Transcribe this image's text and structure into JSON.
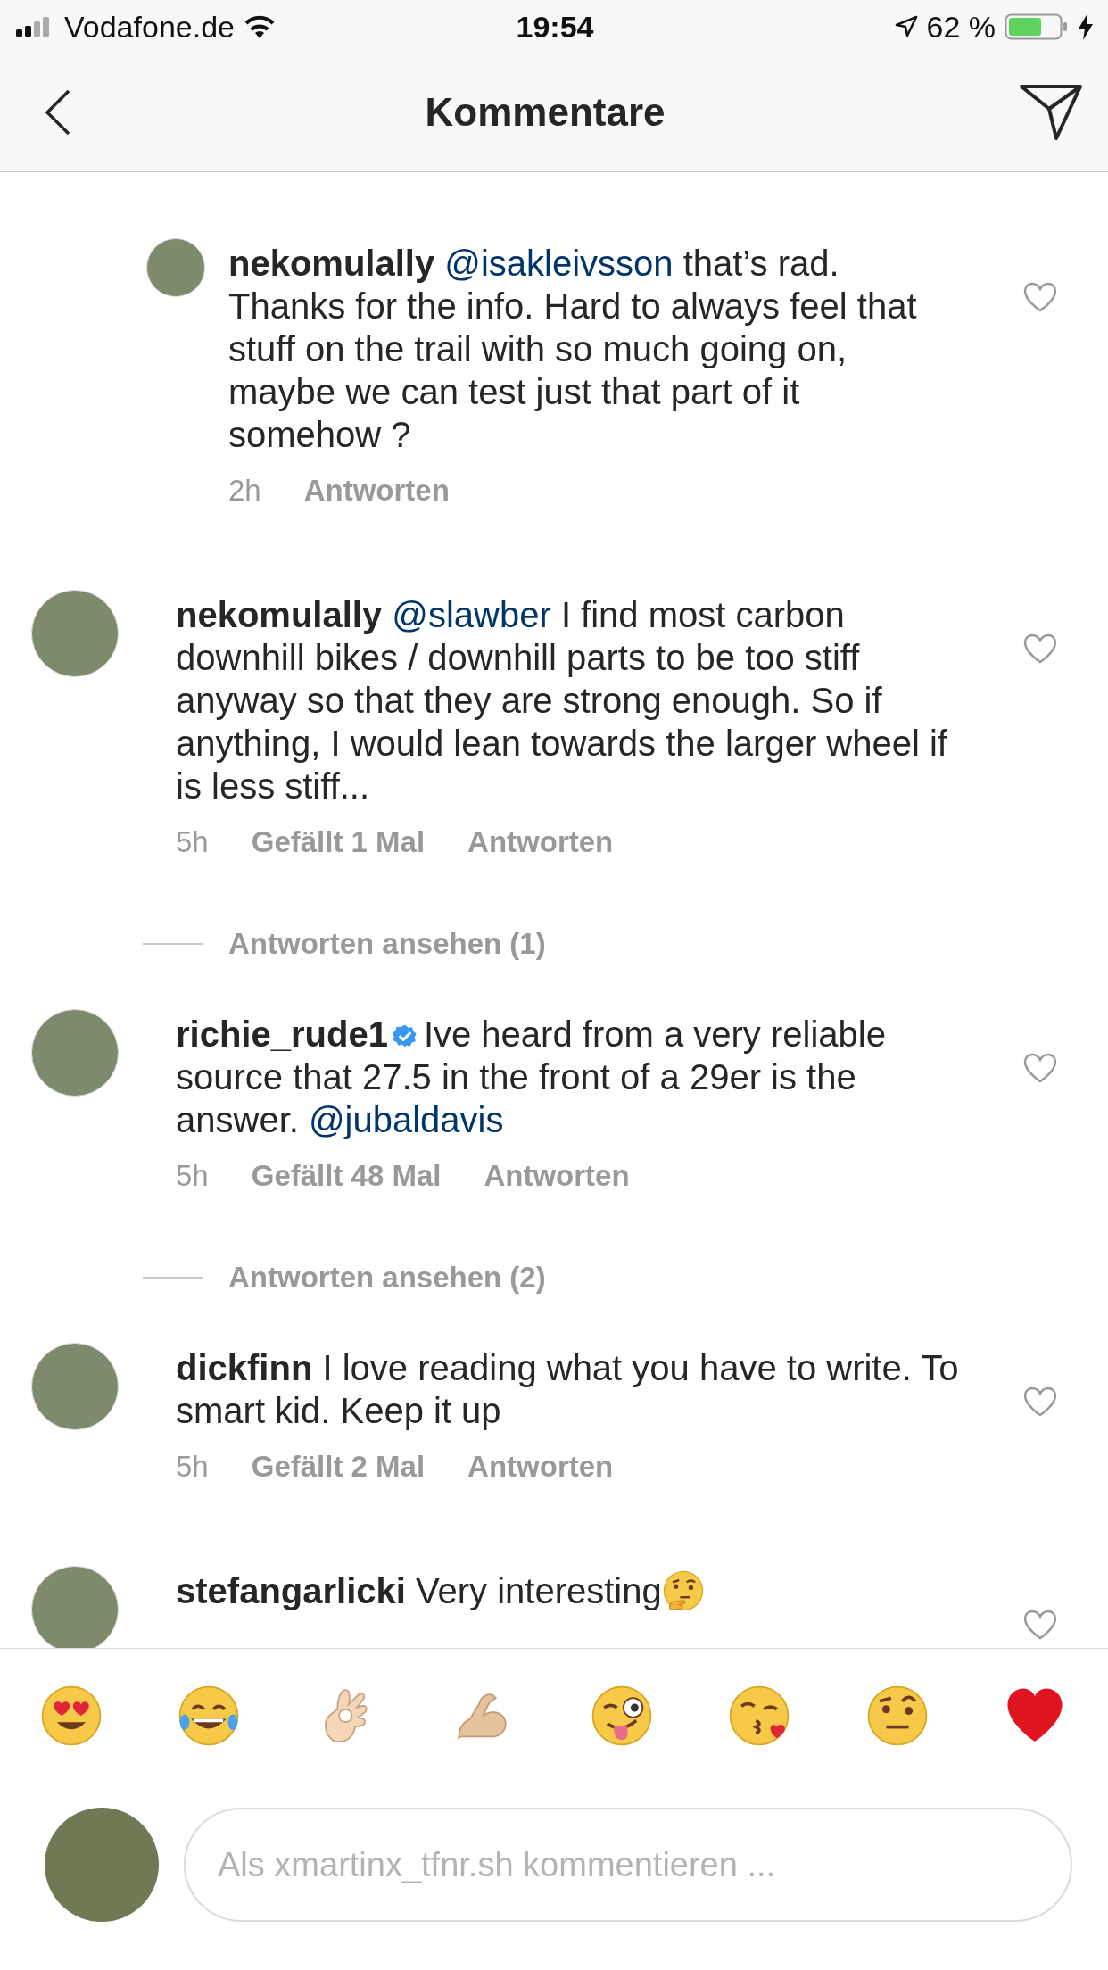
{
  "status_bar": {
    "carrier": "Vodafone.de",
    "time": "19:54",
    "battery": "62 %"
  },
  "header": {
    "title": "Kommentare"
  },
  "comments": [
    {
      "kind": "reply",
      "username": "nekomulally",
      "verified": false,
      "body": [
        {
          "kind": "mention",
          "text": "@isakleivsson"
        },
        {
          "kind": "text",
          "text": " that’s rad. Thanks for the info. Hard to always feel that stuff on the trail with so much going on, maybe we can test just that part of it somehow ?"
        }
      ],
      "time": "2h",
      "reply_label": "Antworten"
    },
    {
      "kind": "comment",
      "username": "nekomulally",
      "verified": false,
      "body": [
        {
          "kind": "mention",
          "text": "@slawber"
        },
        {
          "kind": "text",
          "text": " I find most carbon downhill bikes / downhill parts to be too stiff anyway so that they are strong enough. So if anything, I would lean towards the larger wheel if is less stiff..."
        }
      ],
      "time": "5h",
      "likes": "Gefällt 1 Mal",
      "reply_label": "Antworten"
    },
    {
      "kind": "view_replies",
      "label": "Antworten ansehen (1)"
    },
    {
      "kind": "comment",
      "username": "richie_rude1",
      "verified": true,
      "body": [
        {
          "kind": "text",
          "text": "Ive heard from a very reliable source that 27.5 in the front of a 29er is the answer. "
        },
        {
          "kind": "mention",
          "text": "@jubaldavis"
        }
      ],
      "time": "5h",
      "likes": "Gefällt 48 Mal",
      "reply_label": "Antworten"
    },
    {
      "kind": "view_replies",
      "label": "Antworten ansehen (2)"
    },
    {
      "kind": "comment",
      "username": "dickfinn",
      "verified": false,
      "body": [
        {
          "kind": "text",
          "text": "I love reading what you have to write. To smart kid. Keep it up"
        }
      ],
      "time": "5h",
      "likes": "Gefällt 2 Mal",
      "reply_label": "Antworten"
    },
    {
      "kind": "comment",
      "username": "stefangarlicki",
      "verified": false,
      "body": [
        {
          "kind": "text",
          "text": "Very interesting"
        },
        {
          "kind": "thinking-emoji"
        }
      ]
    }
  ],
  "emoji_bar": [
    {
      "kind": "heart-eyes"
    },
    {
      "kind": "tears-of-joy"
    },
    {
      "kind": "ok-hand"
    },
    {
      "kind": "flexed-arm"
    },
    {
      "kind": "wink-tongue"
    },
    {
      "kind": "kiss-heart"
    },
    {
      "kind": "raised-eyebrow"
    },
    {
      "kind": "red-heart"
    }
  ],
  "composer": {
    "placeholder": "Als xmartinx_tfnr.sh kommentieren ..."
  }
}
